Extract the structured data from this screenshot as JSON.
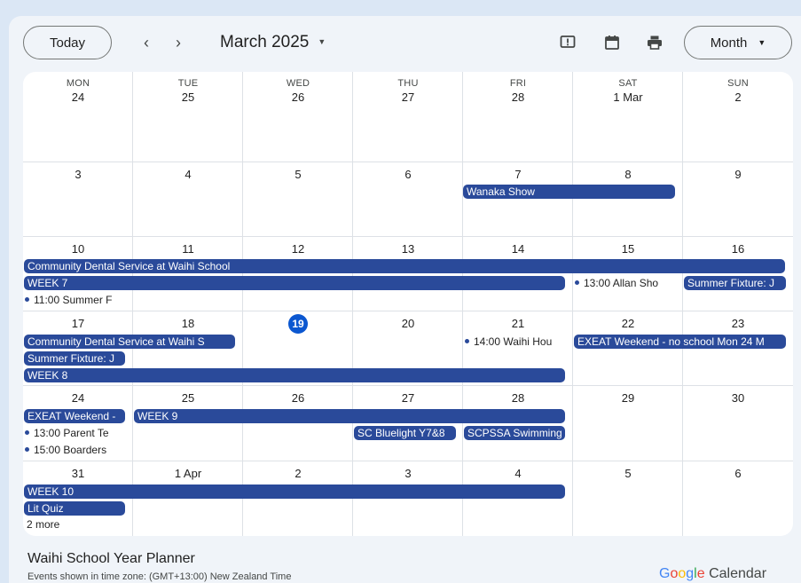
{
  "toolbar": {
    "today_label": "Today",
    "title": "March 2025",
    "view_label": "Month",
    "prev_icon": "chevron-left-icon",
    "next_icon": "chevron-right-icon",
    "feedback_icon": "feedback-icon",
    "calendar_icon": "calendar-icon",
    "print_icon": "print-icon"
  },
  "weekdays": [
    "MON",
    "TUE",
    "WED",
    "THU",
    "FRI",
    "SAT",
    "SUN"
  ],
  "weeks": [
    [
      "24",
      "25",
      "26",
      "27",
      "28",
      "1 Mar",
      "2"
    ],
    [
      "3",
      "4",
      "5",
      "6",
      "7",
      "8",
      "9"
    ],
    [
      "10",
      "11",
      "12",
      "13",
      "14",
      "15",
      "16"
    ],
    [
      "17",
      "18",
      "19",
      "20",
      "21",
      "22",
      "23"
    ],
    [
      "24",
      "25",
      "26",
      "27",
      "28",
      "29",
      "30"
    ],
    [
      "31",
      "1 Apr",
      "2",
      "3",
      "4",
      "5",
      "6"
    ]
  ],
  "today_date": "19",
  "events": {
    "wanaka_show": "Wanaka Show",
    "dental_1": "Community Dental Service at Waihi School",
    "week7": "WEEK 7",
    "summer_f_time": "11:00",
    "summer_f_label": "Summer F",
    "allan_time": "13:00",
    "allan_label": "Allan Sho",
    "summer_fixture_16": "Summer Fixture: J",
    "dental_2": "Community Dental Service at Waihi S",
    "waihi_hou_time": "14:00",
    "waihi_hou_label": "Waihi Hou",
    "exeat_22": "EXEAT Weekend - no school Mon 24 M",
    "summer_fixture_17": "Summer Fixture: J",
    "week8": "WEEK 8",
    "exeat_24": "EXEAT Weekend -",
    "week9": "WEEK 9",
    "parent_time": "13:00",
    "parent_label": "Parent Te",
    "sc_bluelight": "SC Bluelight Y7&8",
    "scpssa": "SCPSSA Swimming",
    "boarders_time": "15:00",
    "boarders_label": "Boarders",
    "week10": "WEEK 10",
    "lit_quiz": "Lit Quiz",
    "more": "2 more"
  },
  "footer": {
    "calendar_name": "Waihi School Year Planner",
    "timezone": "Events shown in time zone: (GMT+13:00) New Zealand Time",
    "brand": "Google",
    "brand_suffix": "Calendar"
  },
  "colors": {
    "event": "#2a4a9a",
    "today_circle": "#0b57d0",
    "background": "#f0f4f9"
  }
}
